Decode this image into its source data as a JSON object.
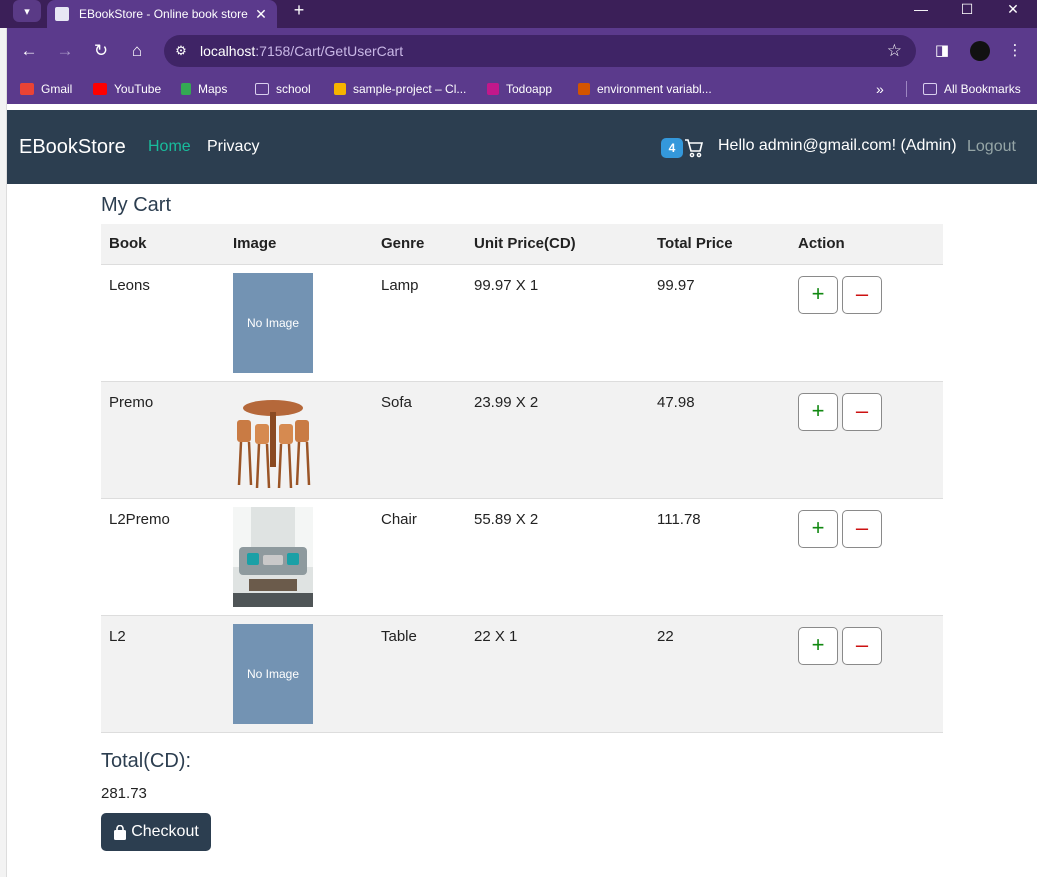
{
  "browser": {
    "tab_title": "EBookStore - Online book store",
    "url_host": "localhost",
    "url_rest": ":7158/Cart/GetUserCart",
    "bookmarks": [
      "Gmail",
      "YouTube",
      "Maps",
      "school",
      "sample-project – Cl...",
      "Todoapp",
      "environment variabl..."
    ],
    "all_bookmarks": "All Bookmarks"
  },
  "nav": {
    "brand": "EBookStore",
    "home": "Home",
    "privacy": "Privacy",
    "cart_count": "4",
    "greeting": "Hello admin@gmail.com! (Admin)",
    "logout": "Logout"
  },
  "cart": {
    "heading": "My Cart",
    "columns": [
      "Book",
      "Image",
      "Genre",
      "Unit Price(CD)",
      "Total Price",
      "Action"
    ],
    "rows": [
      {
        "book": "Leons",
        "image": "No Image",
        "genre": "Lamp",
        "unit": "99.97 X 1",
        "total": "99.97"
      },
      {
        "book": "Premo",
        "image": "chair-table-photo",
        "genre": "Sofa",
        "unit": "23.99 X 2",
        "total": "47.98"
      },
      {
        "book": "L2Premo",
        "image": "sofa-photo",
        "genre": "Chair",
        "unit": "55.89 X 2",
        "total": "111.78"
      },
      {
        "book": "L2",
        "image": "No Image",
        "genre": "Table",
        "unit": "22 X 1",
        "total": "22"
      }
    ],
    "plus_label": "+",
    "minus_label": "–",
    "total_label": "Total(CD):",
    "total_value": "281.73",
    "checkout_label": "Checkout"
  }
}
